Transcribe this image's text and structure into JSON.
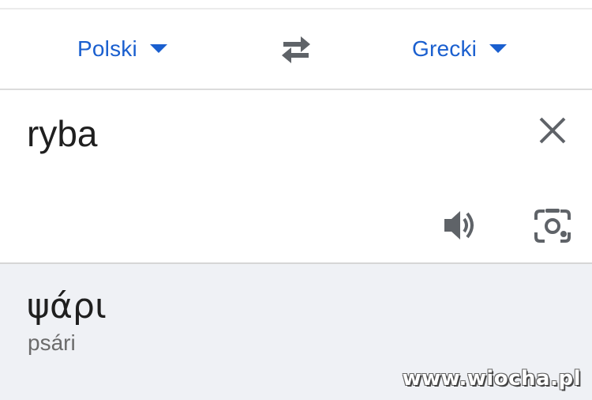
{
  "language_bar": {
    "source_language": "Polski",
    "target_language": "Grecki",
    "swap_icon": "swap-arrows-icon",
    "dropdown_icon": "caret-down-icon",
    "accent_color": "#1a5fcf"
  },
  "input": {
    "text": "ryba",
    "clear_icon": "close-icon",
    "speaker_icon": "speaker-icon",
    "camera_icon": "camera-lens-icon"
  },
  "output": {
    "translation": "ψάρι",
    "transliteration": "psári",
    "background_color": "#eff1f5"
  },
  "watermark": {
    "text": "www.wiocha.pl"
  }
}
